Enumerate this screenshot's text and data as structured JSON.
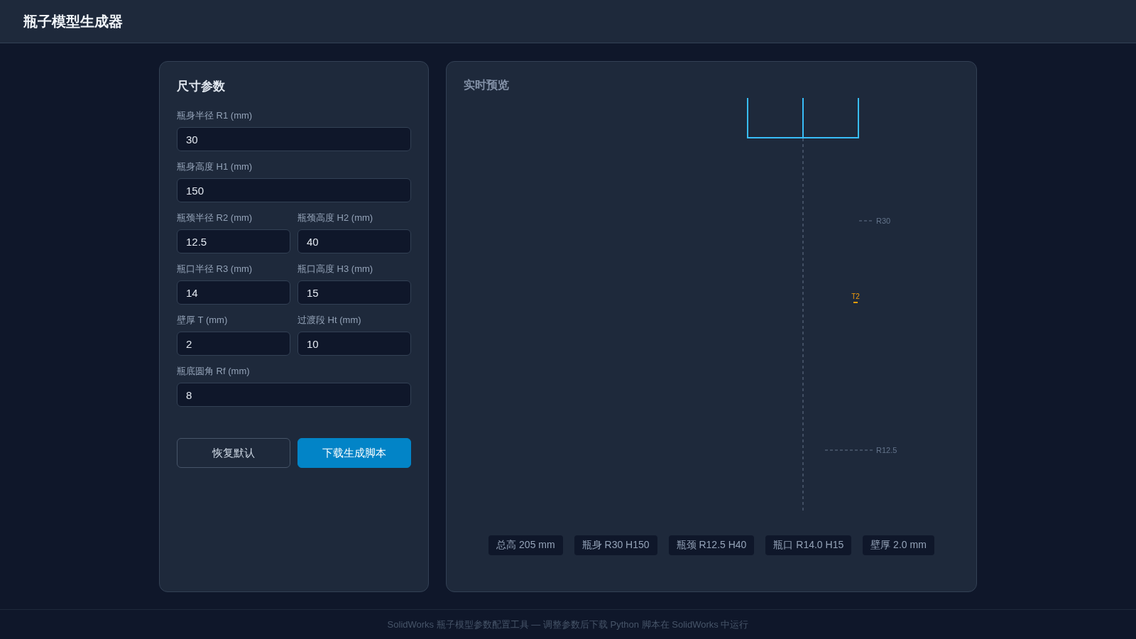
{
  "header": {
    "title": "瓶子模型生成器"
  },
  "parameters": {
    "title": "尺寸参数",
    "rows": [
      [
        {
          "label": "瓶身半径 R1 (mm)",
          "value": "30"
        }
      ],
      [
        {
          "label": "瓶身高度 H1 (mm)",
          "value": "150"
        }
      ],
      [
        {
          "label": "瓶颈半径 R2 (mm)",
          "value": "12.5"
        },
        {
          "label": "瓶颈高度 H2 (mm)",
          "value": "40"
        }
      ],
      [
        {
          "label": "瓶口半径 R3 (mm)",
          "value": "14"
        },
        {
          "label": "瓶口高度 H3 (mm)",
          "value": "15"
        }
      ],
      [
        {
          "label": "壁厚 T (mm)",
          "value": "2"
        },
        {
          "label": "过渡段 Ht (mm)",
          "value": "10"
        }
      ],
      [
        {
          "label": "瓶底圆角 Rf (mm)",
          "value": "8"
        }
      ]
    ],
    "buttons": [
      {
        "label": "恢复默认",
        "kind": "secondary"
      },
      {
        "label": "下载生成脚本",
        "kind": "primary"
      }
    ]
  },
  "preview": {
    "title": "实时预览",
    "annotations": [
      {
        "kind": "radius",
        "label": "R30"
      },
      {
        "kind": "wall",
        "label": "T2"
      },
      {
        "kind": "radius",
        "label": "R12.5"
      }
    ],
    "tags": [
      "总高 205 mm",
      "瓶身 R30 H150",
      "瓶颈 R12.5 H40",
      "瓶口 R14.0 H15",
      "壁厚 2.0 mm"
    ]
  },
  "footer": {
    "text": "SolidWorks 瓶子模型参数配置工具 — 调整参数后下载 Python 脚本在 SolidWorks 中运行"
  }
}
